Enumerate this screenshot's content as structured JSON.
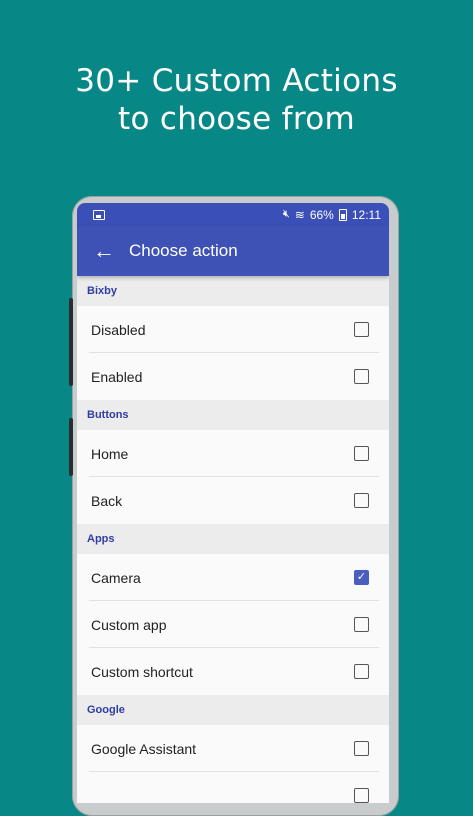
{
  "headline": {
    "line1": "30+ Custom Actions",
    "line2": "to choose from"
  },
  "status_bar": {
    "battery": "66%",
    "time": "12:11"
  },
  "app_bar": {
    "title": "Choose action"
  },
  "sections": [
    {
      "title": "Bixby",
      "items": [
        {
          "label": "Disabled",
          "checked": false
        },
        {
          "label": "Enabled",
          "checked": false
        }
      ]
    },
    {
      "title": "Buttons",
      "items": [
        {
          "label": "Home",
          "checked": false
        },
        {
          "label": "Back",
          "checked": false
        }
      ]
    },
    {
      "title": "Apps",
      "items": [
        {
          "label": "Camera",
          "checked": true
        },
        {
          "label": "Custom app",
          "checked": false
        },
        {
          "label": "Custom shortcut",
          "checked": false
        }
      ]
    },
    {
      "title": "Google",
      "items": [
        {
          "label": "Google Assistant",
          "checked": false
        },
        {
          "label": "",
          "checked": false
        }
      ]
    }
  ],
  "colors": {
    "background": "#078786",
    "app_bar": "#3e51b5",
    "accent": "#4a5dc0",
    "section_text": "#2f3ea0"
  }
}
